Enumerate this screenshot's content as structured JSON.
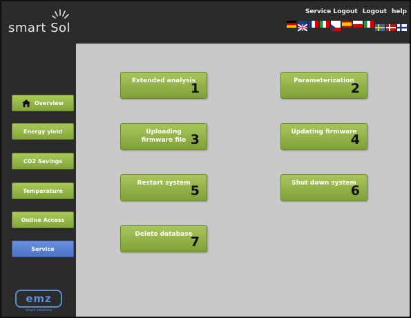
{
  "header": {
    "logo_text": "smart Sol",
    "links": [
      "Service Logout",
      "Logout",
      "help"
    ]
  },
  "languages": [
    "de",
    "en",
    "fr",
    "it",
    "cz",
    "es",
    "pl",
    "it2",
    "se",
    "dk",
    "fi"
  ],
  "sidebar": {
    "items": [
      {
        "label": "Overview",
        "active": false
      },
      {
        "label": "Energy yield",
        "active": false
      },
      {
        "label": "CO2 Savings",
        "active": false
      },
      {
        "label": "Temperature",
        "active": false
      },
      {
        "label": "Online Access",
        "active": false
      },
      {
        "label": "Service",
        "active": true
      }
    ],
    "brand": "emz",
    "brand_sub": "smart solutions"
  },
  "actions": [
    {
      "label": "Extended analysis",
      "number": "1"
    },
    {
      "label": "Parameterization",
      "number": "2"
    },
    {
      "label": "Uploading firmware file",
      "number": "3"
    },
    {
      "label": "Updating firmware",
      "number": "4"
    },
    {
      "label": "Restart system",
      "number": "5"
    },
    {
      "label": "Shut down system",
      "number": "6"
    },
    {
      "label": "Delete database",
      "number": "7"
    }
  ],
  "colors": {
    "accent_green": "#93b548",
    "active_blue": "#5a80d6",
    "dark": "#2b2b2b",
    "content_bg": "#c9c9c9"
  }
}
